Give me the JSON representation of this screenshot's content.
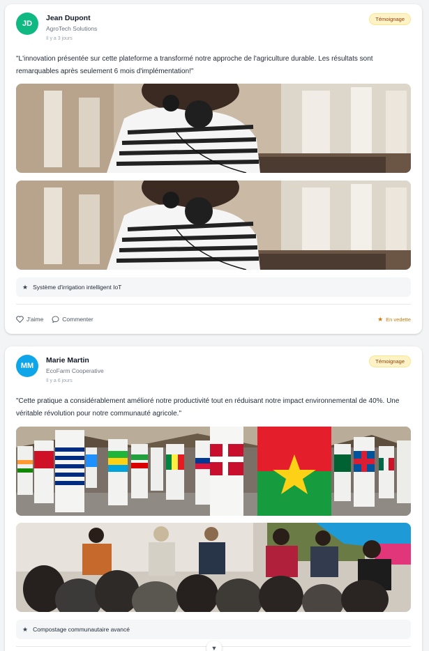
{
  "posts": [
    {
      "avatar_initials": "JD",
      "author_name": "Jean Dupont",
      "company": "AgroTech Solutions",
      "time_ago": "Il y a 3 jours",
      "badge": "Témoignage",
      "quote": "\"L'innovation présentée sur cette plateforme a transformé notre approche de l'agriculture durable. Les résultats sont remarquables après seulement 6 mois d'implémentation!\"",
      "tag": "Système d'irrigation intelligent IoT",
      "like_label": "J'aime",
      "comment_label": "Commenter",
      "featured_label": "En vedette",
      "avatar_color": "#10b981"
    },
    {
      "avatar_initials": "MM",
      "author_name": "Marie Martin",
      "company": "EcoFarm Cooperative",
      "time_ago": "Il y a 6 jours",
      "badge": "Témoignage",
      "quote": "\"Cette pratique a considérablement amélioré notre productivité tout en réduisant notre impact environnemental de 40%. Une véritable révolution pour notre communauté agricole.\"",
      "tag": "Compostage communautaire avancé",
      "avatar_color": "#0ea5e9"
    }
  ],
  "icons": {
    "tag": "star-icon",
    "like": "heart-icon",
    "comment": "comment-icon",
    "featured": "star-icon",
    "scroll": "chevron-down-icon"
  },
  "colors": {
    "badge_bg": "#fef3c7",
    "featured": "#d97706"
  }
}
